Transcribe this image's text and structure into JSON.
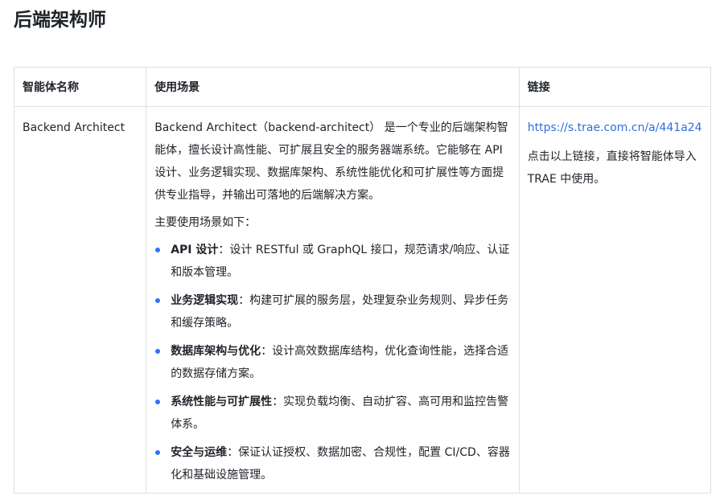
{
  "page_title": "后端架构师",
  "colors": {
    "link": "#2f6fe0",
    "bullet": "#3370ff",
    "border": "#dee0e3",
    "text": "#1f2329"
  },
  "table": {
    "headers": {
      "name": "智能体名称",
      "usage": "使用场景",
      "link": "链接"
    },
    "row": {
      "name": "Backend Architect",
      "description": "Backend Architect（backend-architect） 是一个专业的后端架构智能体，擅长设计高性能、可扩展且安全的服务器端系统。它能够在 API 设计、业务逻辑实现、数据库架构、系统性能优化和可扩展性等方面提供专业指导，并输出可落地的后端解决方案。",
      "scenarios_intro": "主要使用场景如下：",
      "scenarios": [
        {
          "title": "API 设计",
          "text": "：设计 RESTful 或 GraphQL 接口，规范请求/响应、认证和版本管理。"
        },
        {
          "title": "业务逻辑实现",
          "text": "：构建可扩展的服务层，处理复杂业务规则、异步任务和缓存策略。"
        },
        {
          "title": "数据库架构与优化",
          "text": "：设计高效数据库结构，优化查询性能，选择合适的数据存储方案。"
        },
        {
          "title": "系统性能与可扩展性",
          "text": "：实现负载均衡、自动扩容、高可用和监控告警体系。"
        },
        {
          "title": "安全与运维",
          "text": "：保证认证授权、数据加密、合规性，配置 CI/CD、容器化和基础设施管理。"
        }
      ],
      "link_url": "https://s.trae.com.cn/a/441a24",
      "link_note": "点击以上链接，直接将智能体导入 TRAE 中使用。"
    }
  }
}
